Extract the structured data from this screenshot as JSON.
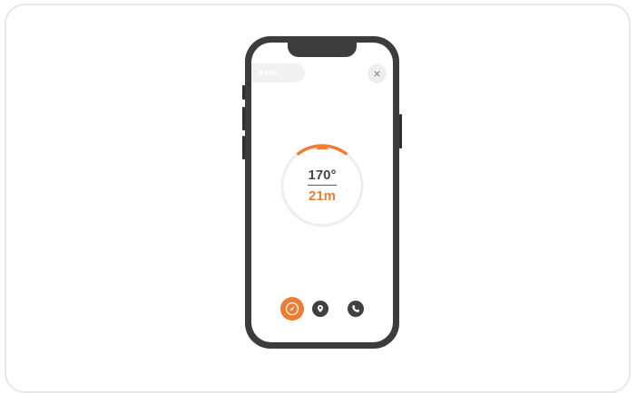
{
  "session": {
    "code": "0438"
  },
  "close": {
    "label": "×"
  },
  "compass": {
    "heading": "170°",
    "distance": "21m"
  },
  "nav": {
    "items": [
      {
        "name": "compass",
        "icon": "compass-icon",
        "active": true
      },
      {
        "name": "location",
        "icon": "map-pin-icon",
        "active": false
      },
      {
        "name": "call",
        "icon": "phone-icon",
        "active": false
      }
    ]
  },
  "colors": {
    "accent": "#ee7c32",
    "dark": "#404040",
    "ring": "#eeeeee",
    "frame": "#3c3c3c"
  }
}
